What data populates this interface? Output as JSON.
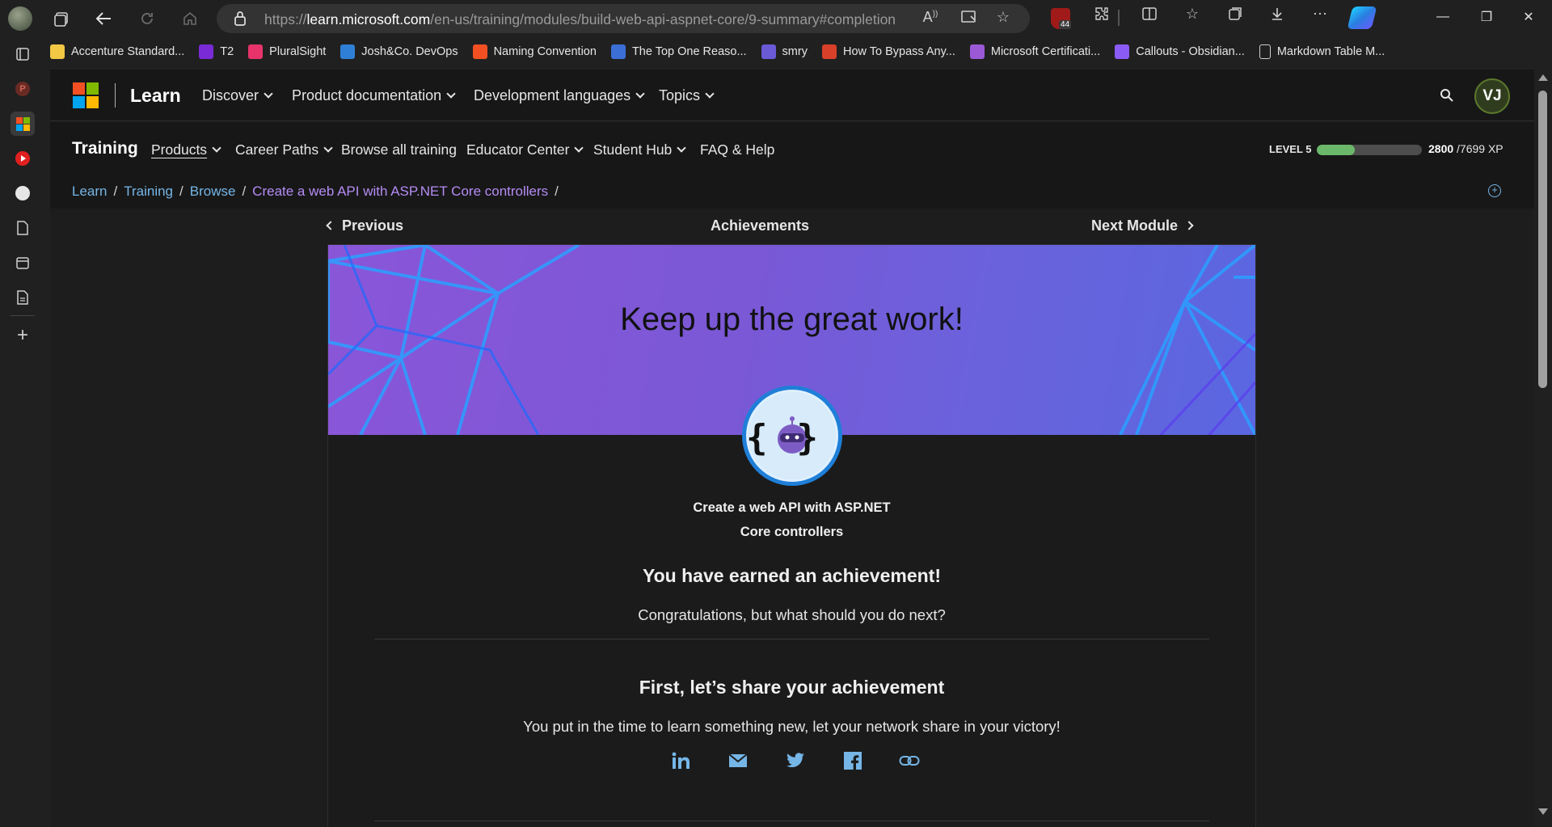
{
  "browser": {
    "url_prefix": "https://",
    "url_host": "learn.microsoft.com",
    "url_path": "/en-us/training/modules/build-web-api-aspnet-core/9-summary#completion",
    "ublock_count": "44"
  },
  "favorites": [
    {
      "label": "Accenture Standard...",
      "icon": "folder-icon",
      "color": "#f2c744"
    },
    {
      "label": "T2",
      "icon": "t2-icon",
      "color": "#7a2ad6"
    },
    {
      "label": "PluralSight",
      "icon": "pluralsight-icon",
      "color": "#e8346a"
    },
    {
      "label": "Josh&Co. DevOps",
      "icon": "azure-devops-icon",
      "color": "#2f7fd6"
    },
    {
      "label": "Naming Convention",
      "icon": "microsoft-icon",
      "color": "#f25022"
    },
    {
      "label": "The Top One Reaso...",
      "icon": "infinity-icon",
      "color": "#3b6fd6"
    },
    {
      "label": "smry",
      "icon": "smry-icon",
      "color": "#6a5ad6"
    },
    {
      "label": "How To Bypass Any...",
      "icon": "bypass-icon",
      "color": "#d8402a"
    },
    {
      "label": "Microsoft Certificati...",
      "icon": "vs-icon",
      "color": "#9b59d6"
    },
    {
      "label": "Callouts - Obsidian...",
      "icon": "obsidian-icon",
      "color": "#8a5cf5"
    },
    {
      "label": "Markdown Table M...",
      "icon": "page-icon",
      "color": "#cfcfcf"
    }
  ],
  "header": {
    "brand": "Learn",
    "nav": [
      "Discover",
      "Product documentation",
      "Development languages",
      "Topics"
    ],
    "avatar_initials": "VJ"
  },
  "training": {
    "title": "Training",
    "nav": [
      "Products",
      "Career Paths",
      "Browse all training",
      "Educator Center",
      "Student Hub",
      "FAQ & Help"
    ],
    "level_label": "LEVEL 5",
    "xp_current": "2800",
    "xp_total": "/7699 XP",
    "xp_fraction": 0.364
  },
  "breadcrumb": [
    "Learn",
    "Training",
    "Browse",
    "Create a web API with ASP.NET Core controllers"
  ],
  "module_nav": {
    "previous": "Previous",
    "title": "Achievements",
    "next": "Next Module"
  },
  "achievement": {
    "hero_title": "Keep up the great work!",
    "module_name_line1": "Create a web API with ASP.NET",
    "module_name_line2": "Core controllers",
    "earned": "You have earned an achievement!",
    "congrats": "Congratulations, but what should you do next?",
    "share_title": "First, let’s share your achievement",
    "share_sub": "You put in the time to learn something new, let your network share in your victory!",
    "share_icons": [
      "linkedin-icon",
      "email-icon",
      "twitter-icon",
      "facebook-icon",
      "link-icon"
    ]
  },
  "colors": {
    "link": "#75b6e7",
    "current_crumb": "#b58cf5",
    "xp_fill": "#6bb86b",
    "hero_start": "#8a56d8",
    "hero_end": "#5a67e0"
  }
}
